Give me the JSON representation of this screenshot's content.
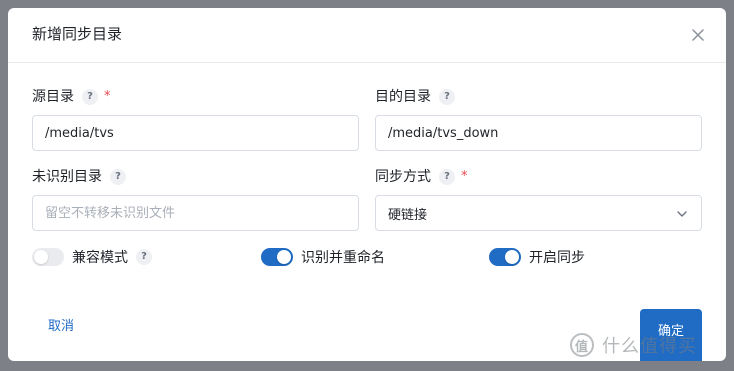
{
  "dialog": {
    "title": "新增同步目录",
    "close_icon": "close-icon"
  },
  "fields": {
    "source_dir": {
      "label": "源目录",
      "help": "?",
      "required_mark": "*",
      "value": "/media/tvs"
    },
    "dest_dir": {
      "label": "目的目录",
      "help": "?",
      "value": "/media/tvs_down"
    },
    "unrecognized_dir": {
      "label": "未识别目录",
      "help": "?",
      "value": "",
      "placeholder": "留空不转移未识别文件"
    },
    "sync_mode": {
      "label": "同步方式",
      "help": "?",
      "required_mark": "*",
      "selected": "硬链接",
      "chevron_icon": "chevron-down-icon"
    }
  },
  "toggles": {
    "compat_mode": {
      "label": "兼容模式",
      "help": "?",
      "on": false
    },
    "rename": {
      "label": "识别并重命名",
      "on": true
    },
    "enable_sync": {
      "label": "开启同步",
      "on": true
    }
  },
  "footer": {
    "cancel_label": "取消",
    "confirm_label": "确定"
  },
  "watermark": {
    "seal_text": "值",
    "text": "什么值得买"
  },
  "colors": {
    "accent": "#206bc4",
    "required": "#e5484d",
    "backdrop": "#7d8187"
  }
}
